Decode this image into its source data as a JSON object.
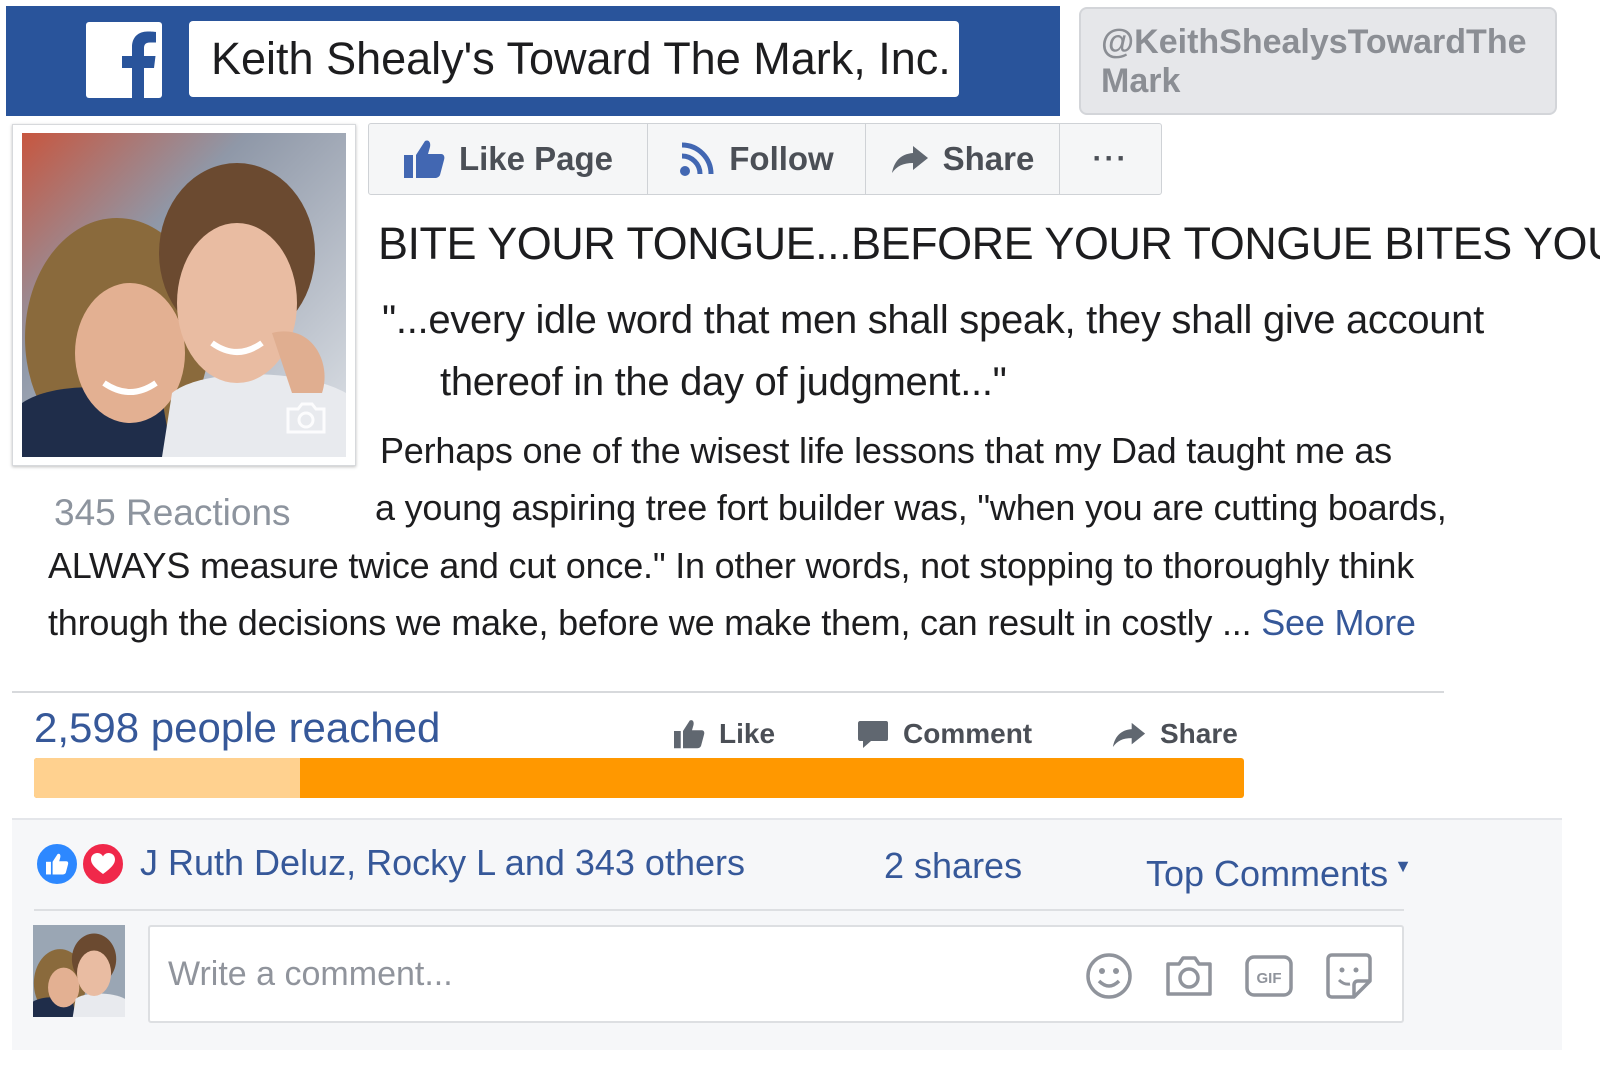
{
  "header": {
    "page_name": "Keith Shealy's Toward The Mark, Inc.",
    "handle": "@KeithShealysTowardTheMark",
    "logo_icon": "facebook-f-icon",
    "brand_color": "#29549b"
  },
  "actions": {
    "like_page": "Like Page",
    "follow": "Follow",
    "share": "Share",
    "more": "···"
  },
  "post": {
    "title": "BITE YOUR TONGUE...BEFORE YOUR TONGUE BITES YOU!",
    "quote_line1": "\"...every idle word that men shall speak, they shall give account",
    "quote_line2": "thereof in the day of judgment...\"",
    "body_line1": "Perhaps one of the wisest life lessons that my Dad taught me as",
    "body_line2": "a young aspiring tree fort builder was, \"when you are cutting boards,",
    "body_line3": "ALWAYS measure twice and cut once.\" In other words, not stopping to thoroughly think",
    "body_line4": "through the decisions we make, before we make them, can result in costly ...",
    "see_more": "See More",
    "reactions_label": "345 Reactions"
  },
  "insights": {
    "reached_label": "2,598 people reached",
    "organic_fraction": 0.22,
    "bar_color": "#ff9800",
    "bar_light_color": "#ffd18f"
  },
  "ufi": {
    "like": "Like",
    "comment": "Comment",
    "share": "Share"
  },
  "social": {
    "reactors": "J Ruth Deluz, Rocky L  and 343 others",
    "shares": "2 shares",
    "top_comments": "Top Comments",
    "like_color": "#2d88ff",
    "love_color": "#f0284a"
  },
  "comment_box": {
    "placeholder": "Write a comment...",
    "tools": [
      "emoji-icon",
      "camera-icon",
      "gif-icon",
      "sticker-icon"
    ]
  }
}
